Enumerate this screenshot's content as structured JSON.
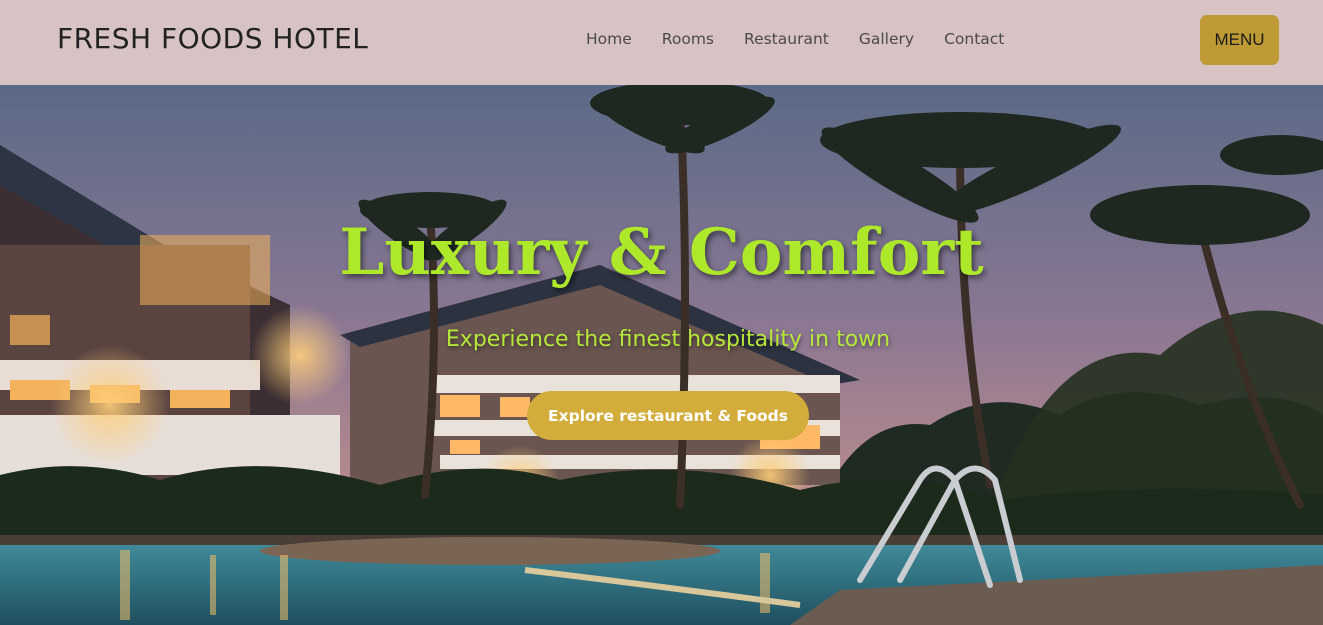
{
  "header": {
    "brand": "FRESH FOODS HOTEL",
    "nav": [
      "Home",
      "Rooms",
      "Restaurant",
      "Gallery",
      "Contact"
    ],
    "menu_label": "MENU"
  },
  "hero": {
    "title": "Luxury & Comfort",
    "subtitle": "Experience the finest hospitality in town",
    "cta_label": "Explore restaurant & Foods"
  },
  "colors": {
    "header_bg": "#d8c3c4",
    "menu_bg": "#bd9a33",
    "title": "#aee82a",
    "subtitle": "#b6e83a",
    "cta_bg": "#d3ad3c"
  }
}
